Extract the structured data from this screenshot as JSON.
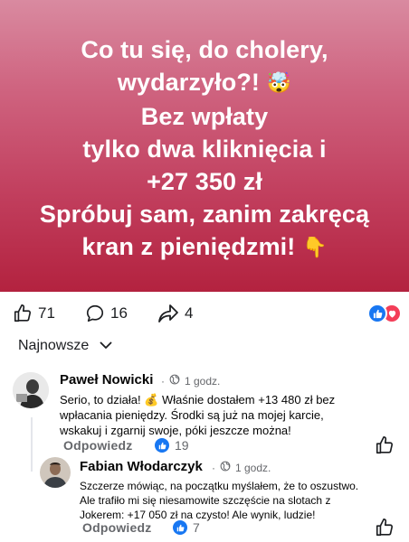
{
  "post": {
    "banner_lines": [
      "Co tu się, do cholery,",
      "wydarzyło?!",
      "Bez wpłaty",
      "tylko dwa kliknięcia i",
      "+27 350 zł",
      "Spróbuj sam, zanim zakręcą",
      "kran z pieniędzmi!"
    ],
    "emoji_shocked": "🤯",
    "emoji_pointing": "👇",
    "likes": "71",
    "comments": "16",
    "shares": "4"
  },
  "sort": {
    "label": "Najnowsze"
  },
  "comments": [
    {
      "author": "Paweł Nowicki",
      "time": "1 godz.",
      "lines": [
        "Serio, to działa! 💰 Właśnie dostałem +13 480 zł bez",
        "wpłacania pieniędzy. Środki są już na mojej karcie,",
        "wskakuj i zgarnij swoje, póki jeszcze można!"
      ],
      "reply_label": "Odpowiedz",
      "likes": "19"
    },
    {
      "author": "Fabian Włodarczyk",
      "time": "1 godz.",
      "lines": [
        "Szczerze mówiąc, na początku myślałem, że to oszustwo.",
        "Ale trafiło mi się niesamowite szczęście na slotach z",
        "Jokerem: +17 050 zł na czysto! Ale wynik, ludzie!"
      ],
      "reply_label": "Odpowiedz",
      "likes": "7"
    }
  ],
  "colors": {
    "accent": "#1877f2",
    "love": "#f33e58",
    "muted": "#65676b"
  }
}
